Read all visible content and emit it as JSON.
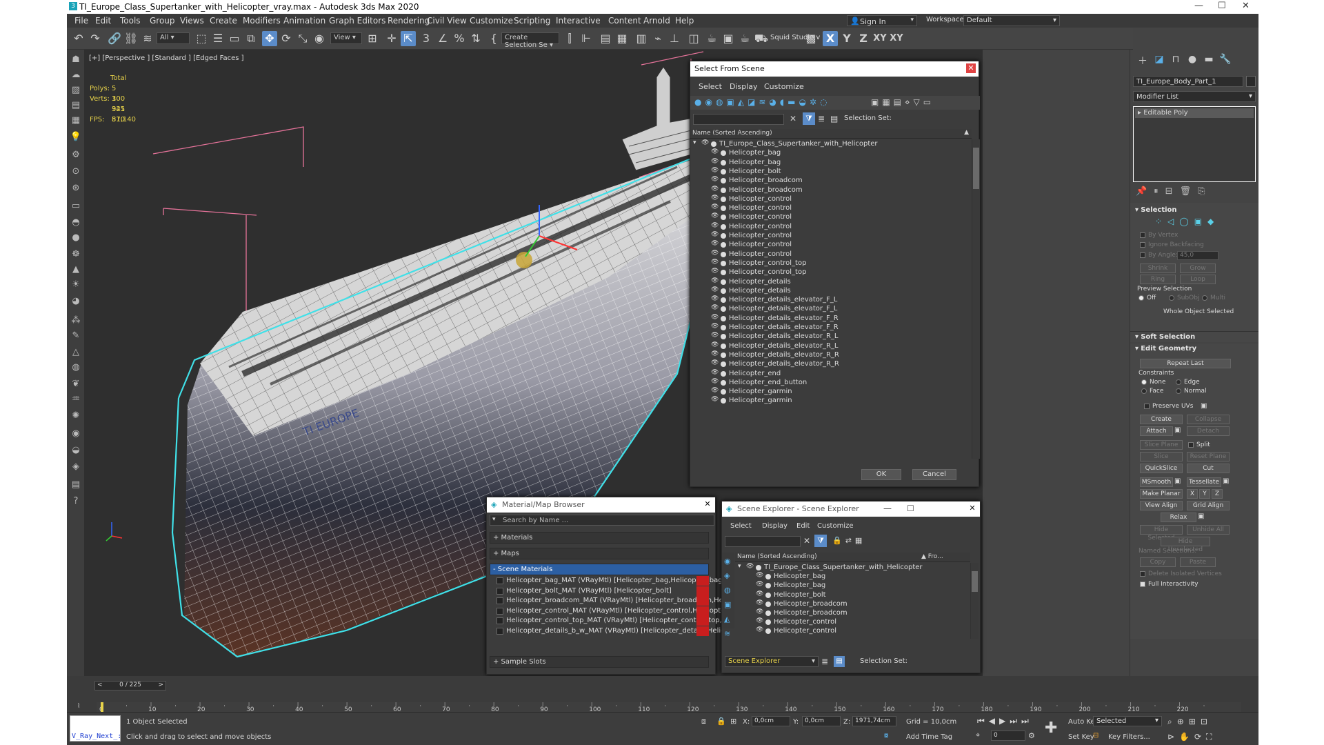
{
  "window": {
    "title": "TI_Europe_Class_Supertanker_with_Helicopter_vray.max - Autodesk 3ds Max 2020",
    "controls": [
      "—",
      "☐",
      "✕"
    ]
  },
  "menu": [
    "File",
    "Edit",
    "Tools",
    "Group",
    "Views",
    "Create",
    "Modifiers",
    "Animation",
    "Graph Editors",
    "Rendering",
    "Civil View",
    "Customize",
    "Scripting",
    "Interactive",
    "Content",
    "Arnold",
    "Help"
  ],
  "account": {
    "sign_in": "Sign In",
    "workspaces_label": "Workspaces:",
    "workspace": "Default"
  },
  "toolbar": {
    "filter": "All",
    "ref_coord": "View",
    "named_selection": "Create Selection Se",
    "squid": "Squid Studio v",
    "axis_labels": [
      "X",
      "Y",
      "Z",
      "XY",
      "XY"
    ]
  },
  "viewport": {
    "label": "[+] [Perspective ] [Standard ] [Edged Faces ]",
    "stats": {
      "total_label": "Total",
      "polys_label": "Polys:",
      "polys": "5 100 325",
      "verts_label": "Verts:",
      "verts": "3 941 870",
      "fps_label": "FPS:",
      "fps": "51,140"
    },
    "hull_text": "TI EUROPE"
  },
  "select_from_scene": {
    "title": "Select From Scene",
    "menu": [
      "Select",
      "Display",
      "Customize"
    ],
    "selection_set_label": "Selection Set:",
    "column": "Name (Sorted Ascending)",
    "root": "TI_Europe_Class_Supertanker_with_Helicopter",
    "items": [
      "Helicopter_bag",
      "Helicopter_bag",
      "Helicopter_bolt",
      "Helicopter_broadcom",
      "Helicopter_broadcom",
      "Helicopter_control",
      "Helicopter_control",
      "Helicopter_control",
      "Helicopter_control",
      "Helicopter_control",
      "Helicopter_control",
      "Helicopter_control",
      "Helicopter_control_top",
      "Helicopter_control_top",
      "Helicopter_details",
      "Helicopter_details",
      "Helicopter_details_elevator_F_L",
      "Helicopter_details_elevator_F_L",
      "Helicopter_details_elevator_F_R",
      "Helicopter_details_elevator_F_R",
      "Helicopter_details_elevator_R_L",
      "Helicopter_details_elevator_R_L",
      "Helicopter_details_elevator_R_R",
      "Helicopter_details_elevator_R_R",
      "Helicopter_end",
      "Helicopter_end_button",
      "Helicopter_garmin",
      "Helicopter_garmin"
    ],
    "ok": "OK",
    "cancel": "Cancel"
  },
  "material_browser": {
    "title": "Material/Map Browser",
    "search_placeholder": "Search by Name ...",
    "sections": [
      "+ Materials",
      "+ Maps",
      "- Scene Materials",
      "+ Sample Slots"
    ],
    "materials": [
      "Helicopter_bag_MAT (VRayMtl) [Helicopter_bag,Helicopter_bag]",
      "Helicopter_bolt_MAT (VRayMtl) [Helicopter_bolt]",
      "Helicopter_broadcom_MAT (VRayMtl) [Helicopter_broadcom,Helicopter_b...",
      "Helicopter_control_MAT (VRayMtl) [Helicopter_control,Helicopter_control,...",
      "Helicopter_control_top_MAT (VRayMtl) [Helicopter_control_top,Helicopter...",
      "Helicopter_details_b_w_MAT (VRayMtl) [Helicopter_details,Helicopter_det..."
    ]
  },
  "scene_explorer": {
    "title": "Scene Explorer - Scene Explorer",
    "menu": [
      "Select",
      "Display",
      "Edit",
      "Customize"
    ],
    "column": "Name (Sorted Ascending)",
    "column2": "▲ Fro...",
    "root": "TI_Europe_Class_Supertanker_with_Helicopter",
    "items": [
      "Helicopter_bag",
      "Helicopter_bag",
      "Helicopter_bolt",
      "Helicopter_broadcom",
      "Helicopter_broadcom",
      "Helicopter_control",
      "Helicopter_control"
    ],
    "explorer_name": "Scene Explorer",
    "selection_set_label": "Selection Set:"
  },
  "command_panel": {
    "object_name": "TI_Europe_Body_Part_1",
    "modifier_list": "Modifier List",
    "modifier": "Editable Poly",
    "selection": {
      "title": "Selection",
      "by_vertex": "By Vertex",
      "ignore_backfacing": "Ignore Backfacing",
      "by_angle": "By Angle:",
      "angle": "45,0",
      "shrink": "Shrink",
      "grow": "Grow",
      "ring": "Ring",
      "loop": "Loop",
      "preview": "Preview Selection",
      "off": "Off",
      "subobj": "SubObj",
      "multi": "Multi",
      "whole": "Whole Object Selected"
    },
    "soft_selection": "Soft Selection",
    "edit_geometry": {
      "title": "Edit Geometry",
      "repeat_last": "Repeat Last",
      "constraints": "Constraints",
      "none": "None",
      "edge": "Edge",
      "face": "Face",
      "normal": "Normal",
      "preserve_uvs": "Preserve UVs",
      "create": "Create",
      "collapse": "Collapse",
      "attach": "Attach",
      "detach": "Detach",
      "slice_plane": "Slice Plane",
      "split": "Split",
      "slice": "Slice",
      "reset_plane": "Reset Plane",
      "quickslice": "QuickSlice",
      "cut": "Cut",
      "msmooth": "MSmooth",
      "tessellate": "Tessellate",
      "make_planar": "Make Planar",
      "x": "X",
      "y": "Y",
      "z": "Z",
      "view_align": "View Align",
      "grid_align": "Grid Align",
      "relax": "Relax",
      "hide_selected": "Hide Selected",
      "unhide_all": "Unhide All",
      "hide_unselected": "Hide Unselected",
      "named_selections": "Named Selections:",
      "copy": "Copy",
      "paste": "Paste",
      "delete_isolated": "Delete Isolated Vertices",
      "full_interactivity": "Full Interactivity"
    }
  },
  "timeline": {
    "frame": "0 / 225",
    "ticks": [
      "0",
      "10",
      "20",
      "30",
      "40",
      "50",
      "60",
      "70",
      "80",
      "90",
      "100",
      "110",
      "120",
      "130",
      "140",
      "150",
      "160",
      "170",
      "180",
      "190",
      "200",
      "210",
      "220"
    ]
  },
  "status": {
    "script": "V_Ray_Next_:",
    "selected": "1 Object Selected",
    "prompt": "Click and drag to select and move objects",
    "x_label": "X:",
    "x": "0,0cm",
    "y_label": "Y:",
    "y": "0,0cm",
    "z_label": "Z:",
    "z": "1971,74cm",
    "grid": "Grid = 10,0cm",
    "add_time_tag": "Add Time Tag",
    "auto_key": "Auto Key",
    "set_key": "Set Key",
    "selected_dd": "Selected",
    "key_filters": "Key Filters...",
    "frame_field": "0"
  }
}
